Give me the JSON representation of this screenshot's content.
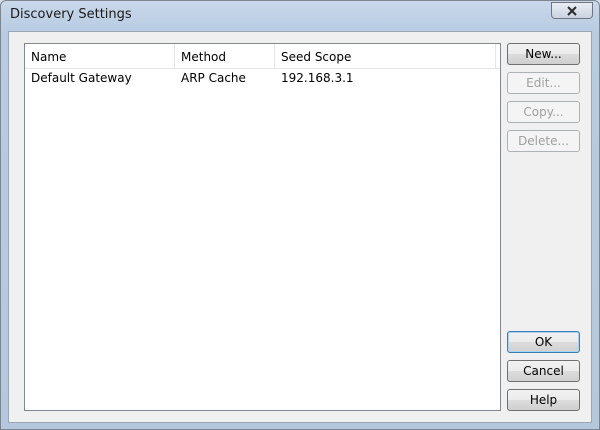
{
  "window": {
    "title": "Discovery Settings"
  },
  "list": {
    "columns": [
      "Name",
      "Method",
      "Seed Scope"
    ],
    "rows": [
      {
        "name": "Default Gateway",
        "method": "ARP Cache",
        "seed_scope": "192.168.3.1"
      }
    ]
  },
  "buttons": {
    "new": "New...",
    "edit": "Edit...",
    "copy": "Copy...",
    "delete": "Delete...",
    "ok": "OK",
    "cancel": "Cancel",
    "help": "Help"
  },
  "icons": {
    "close": "close-icon"
  }
}
